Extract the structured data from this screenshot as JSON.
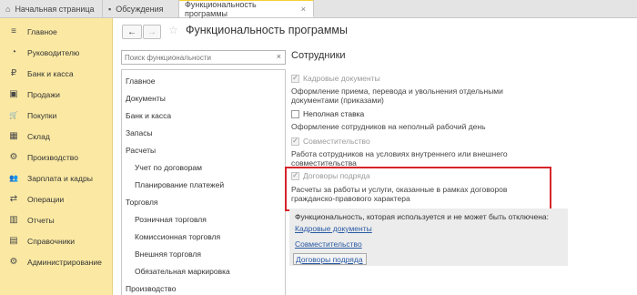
{
  "tabs": [
    {
      "label": "Начальная страница",
      "icon": "home-icon",
      "glyph": "⌂"
    },
    {
      "label": "Обсуждения",
      "icon": "chat-icon",
      "glyph": "▪"
    },
    {
      "label": "Функциональность программы",
      "icon": "",
      "glyph": "",
      "active": true,
      "close": "×"
    }
  ],
  "sidebar": {
    "items": [
      {
        "label": "Главное",
        "icon": "menu-icon",
        "glyph": "≡"
      },
      {
        "label": "Руководителю",
        "icon": "chart-icon",
        "glyph": "◔"
      },
      {
        "label": "Банк и касса",
        "icon": "bank-icon",
        "glyph": "₽"
      },
      {
        "label": "Продажи",
        "icon": "sales-icon",
        "glyph": "▣"
      },
      {
        "label": "Покупки",
        "icon": "cart-icon",
        "glyph": "🛒"
      },
      {
        "label": "Склад",
        "icon": "warehouse-icon",
        "glyph": "▦"
      },
      {
        "label": "Производство",
        "icon": "factory-icon",
        "glyph": "⚙"
      },
      {
        "label": "Зарплата и кадры",
        "icon": "people-icon",
        "glyph": "👥"
      },
      {
        "label": "Операции",
        "icon": "operations-icon",
        "glyph": "⇄"
      },
      {
        "label": "Отчеты",
        "icon": "reports-icon",
        "glyph": "▥"
      },
      {
        "label": "Справочники",
        "icon": "book-icon",
        "glyph": "▤"
      },
      {
        "label": "Администрирование",
        "icon": "gear-icon",
        "glyph": "⚙"
      }
    ]
  },
  "toolbar": {
    "back": "←",
    "forward": "→",
    "star": "☆",
    "title": "Функциональность программы"
  },
  "search": {
    "placeholder": "Поиск функциональности",
    "clear": "×"
  },
  "sections": [
    {
      "label": "Главное",
      "sub": false
    },
    {
      "label": "Документы",
      "sub": false
    },
    {
      "label": "Банк и касса",
      "sub": false
    },
    {
      "label": "Запасы",
      "sub": false
    },
    {
      "label": "Расчеты",
      "sub": false
    },
    {
      "label": "Учет по договорам",
      "sub": true
    },
    {
      "label": "Планирование платежей",
      "sub": true
    },
    {
      "label": "Торговля",
      "sub": false
    },
    {
      "label": "Розничная торговля",
      "sub": true
    },
    {
      "label": "Комиссионная торговля",
      "sub": true
    },
    {
      "label": "Внешняя торговля",
      "sub": true
    },
    {
      "label": "Обязательная маркировка",
      "sub": true
    },
    {
      "label": "Производство",
      "sub": false
    }
  ],
  "panel": {
    "title": "Сотрудники",
    "options": [
      {
        "label": "Кадровые документы",
        "checked": true,
        "disabled": true,
        "desc": "Оформление приема, перевода и увольнения отдельными документами (приказами)"
      },
      {
        "label": "Неполная ставка",
        "checked": false,
        "disabled": false,
        "desc": "Оформление сотрудников на неполный рабочий день"
      },
      {
        "label": "Совместительство",
        "checked": true,
        "disabled": true,
        "desc": "Работа сотрудников на условиях внутреннего или внешнего совместительства"
      },
      {
        "label": "Договоры подряда",
        "checked": true,
        "disabled": true,
        "desc": "Расчеты за работы и услуги, оказанные в рамках договоров гражданско-правового характера"
      }
    ],
    "check_glyph": "✓",
    "info": {
      "text": "Функциональность, которая используется и не может быть отключена:",
      "links": [
        "Кадровые документы",
        "Совместительство",
        "Договоры подряда"
      ]
    }
  }
}
